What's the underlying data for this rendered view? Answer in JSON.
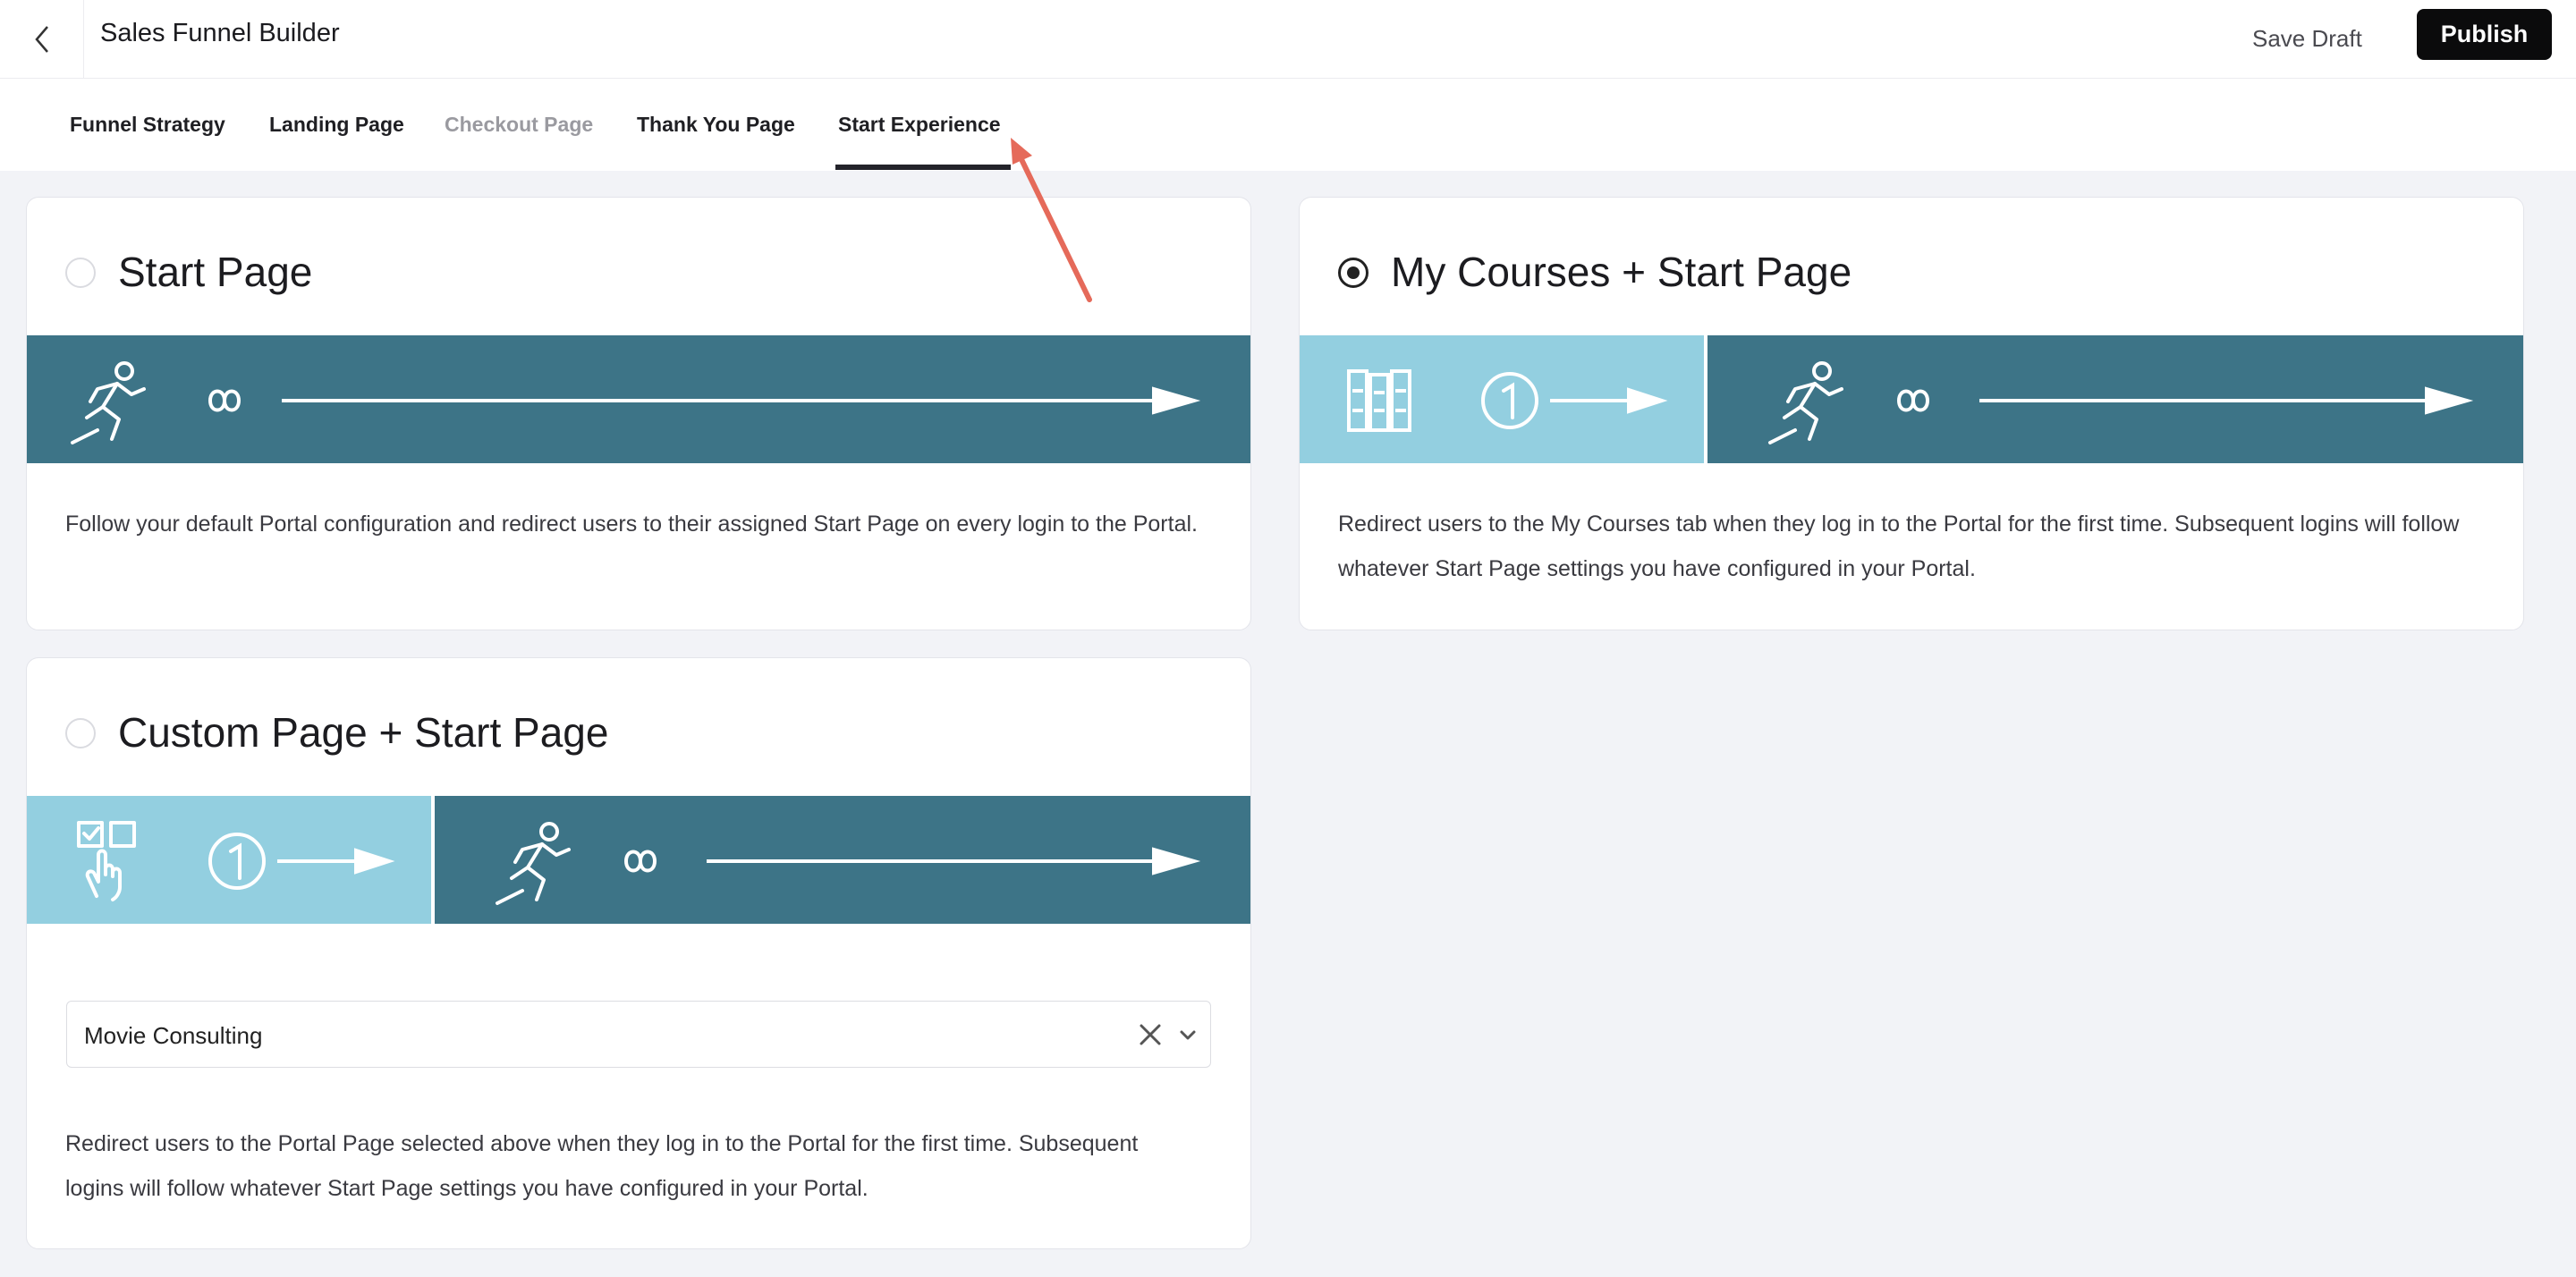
{
  "header": {
    "title": "Sales Funnel Builder",
    "save_draft_label": "Save Draft",
    "publish_label": "Publish"
  },
  "tabs": [
    {
      "label": "Funnel Strategy",
      "state": "normal"
    },
    {
      "label": "Landing Page",
      "state": "normal"
    },
    {
      "label": "Checkout Page",
      "state": "disabled"
    },
    {
      "label": "Thank You Page",
      "state": "normal"
    },
    {
      "label": "Start Experience",
      "state": "active"
    }
  ],
  "options": {
    "start_page": {
      "title": "Start Page",
      "selected": false,
      "description": "Follow your default Portal configuration and redirect users to their assigned Start Page on every login to the Portal."
    },
    "my_courses": {
      "title": "My Courses + Start Page",
      "selected": true,
      "description": "Redirect users to the My Courses tab when they log in to the Portal for the first time. Subsequent logins will follow whatever Start Page settings you have configured in your Portal."
    },
    "custom_page": {
      "title": "Custom Page + Start Page",
      "selected": false,
      "select_value": "Movie Consulting",
      "description": "Redirect users to the Portal Page selected above when they log in to the Portal for the first time. Subsequent logins will follow whatever Start Page settings you have configured in your Portal."
    }
  },
  "colors": {
    "banner_dark": "#3d7487",
    "banner_light": "#93cfe0",
    "annotation_arrow": "#e56a5a",
    "accent_black": "#0b0b0c"
  },
  "icons": [
    "chevron-left-icon",
    "running-person-icon",
    "infinity-icon",
    "long-arrow-icon",
    "books-icon",
    "number-one-icon",
    "click-hand-icon",
    "clear-x-icon",
    "chevron-down-icon"
  ]
}
